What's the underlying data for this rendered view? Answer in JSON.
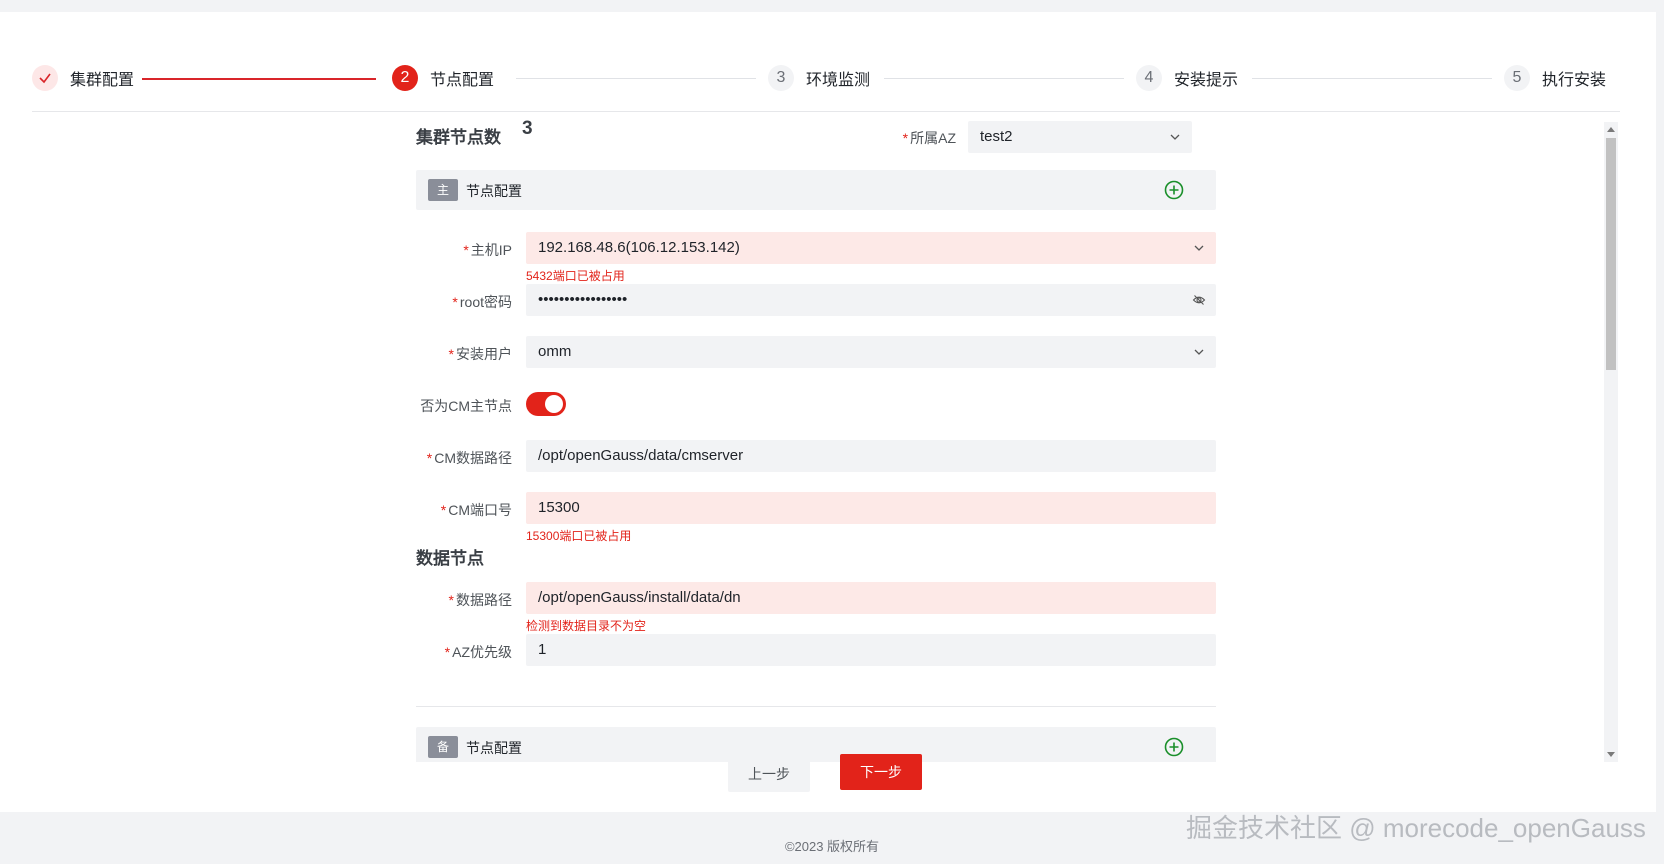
{
  "steps": [
    {
      "num": "",
      "title": "集群配置"
    },
    {
      "num": "2",
      "title": "节点配置"
    },
    {
      "num": "3",
      "title": "环境监测"
    },
    {
      "num": "4",
      "title": "安装提示"
    },
    {
      "num": "5",
      "title": "执行安装"
    }
  ],
  "cluster": {
    "node_count_label": "集群节点数",
    "node_count": "3",
    "az_label": "所属AZ",
    "az_value": "test2"
  },
  "primary_section": {
    "tag": "主",
    "title": "节点配置"
  },
  "standby_section": {
    "tag": "备",
    "title": "节点配置"
  },
  "fields": {
    "host_ip": {
      "label": "主机IP",
      "value": "192.168.48.6(106.12.153.142)",
      "error": "5432端口已被占用"
    },
    "root_password": {
      "label": "root密码",
      "value": "•••••••••••••••••"
    },
    "install_user": {
      "label": "安装用户",
      "value": "omm"
    },
    "cm_master": {
      "label": "否为CM主节点",
      "on": true
    },
    "cm_data_path": {
      "label": "CM数据路径",
      "value": "/opt/openGauss/data/cmserver"
    },
    "cm_port": {
      "label": "CM端口号",
      "value": "15300",
      "error": "15300端口已被占用"
    },
    "data_node_title": "数据节点",
    "data_path": {
      "label": "数据路径",
      "value": "/opt/openGauss/install/data/dn",
      "error": "检测到数据目录不为空"
    },
    "az_priority": {
      "label": "AZ优先级",
      "value": "1"
    }
  },
  "buttons": {
    "prev": "上一步",
    "next": "下一步"
  },
  "footer": "©2023 版权所有",
  "watermark": "掘金技术社区 @ morecode_openGauss",
  "colors": {
    "accent": "#e2231a",
    "field_bg": "#f2f3f5",
    "error_bg": "#fde9e7"
  }
}
